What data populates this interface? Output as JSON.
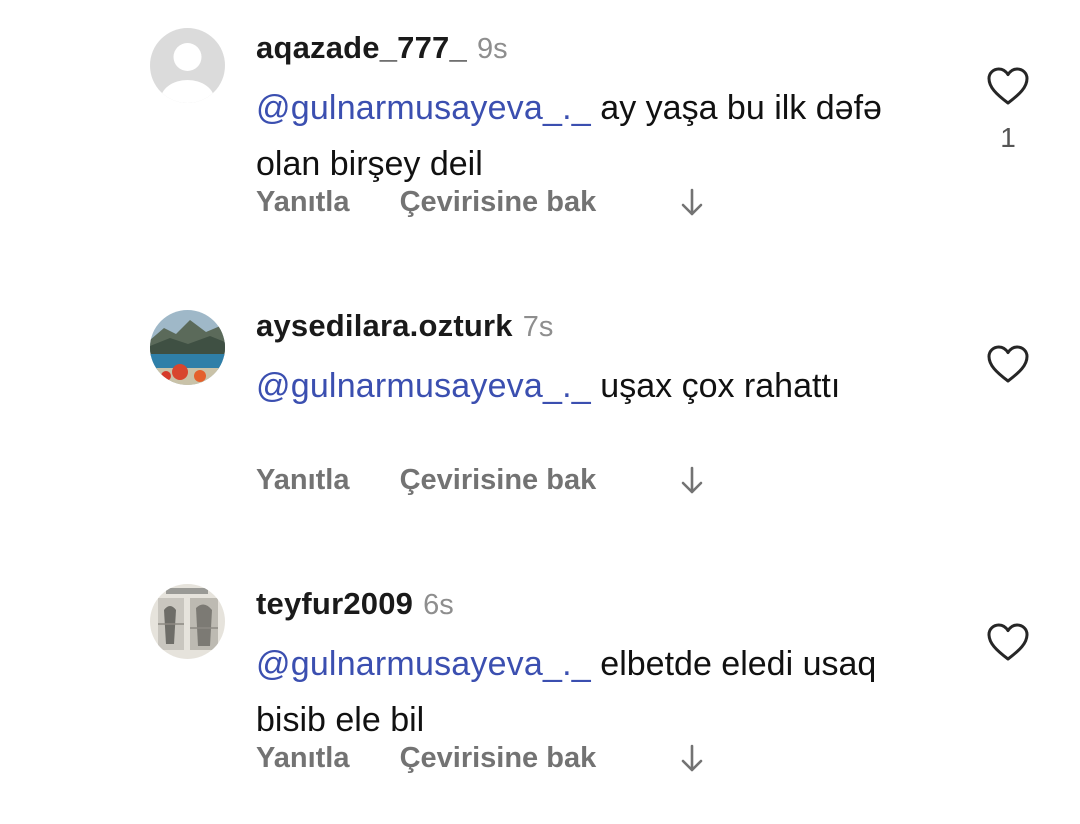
{
  "comments": [
    {
      "username": "aqazade_777_",
      "time": "9s",
      "mention": "gulnarmusayeva_._",
      "text": " ay yaşa bu ilk dəfə olan birşey deil",
      "reply_label": "Yanıtla",
      "translate_label": "Çevirisine bak",
      "like_count": "1",
      "avatar": "default-avatar-icon"
    },
    {
      "username": "aysedilara.ozturk",
      "time": "7s",
      "mention": "gulnarmusayeva_._",
      "text": " uşax çox rahattı",
      "reply_label": "Yanıtla",
      "translate_label": "Çevirisine bak",
      "like_count": "",
      "avatar": "landscape-photo-avatar"
    },
    {
      "username": "teyfur2009",
      "time": "6s",
      "mention": "gulnarmusayeva_._",
      "text": " elbetde eledi usaq bisib ele bil",
      "reply_label": "Yanıtla",
      "translate_label": "Çevirisine bak",
      "like_count": "",
      "avatar": "sketch-photo-avatar"
    }
  ],
  "colors": {
    "mention": "#3b4fb0",
    "secondary_text": "#737373",
    "timestamp": "#8e8e8e"
  }
}
